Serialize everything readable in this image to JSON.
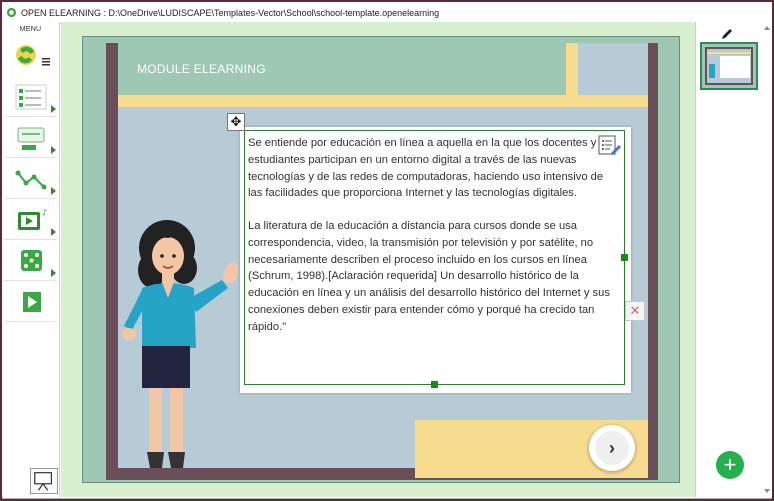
{
  "window": {
    "title": "OPEN ELEARNING : D:\\OneDrive\\LUDISCAPE\\Templates-Vector\\School\\school-template.openelearning"
  },
  "menu": {
    "label": "MENU"
  },
  "slide": {
    "module_title": "MODULE ELEARNING",
    "paragraph1": "Se entiende por educación en línea a aquella en la que los docentes y estudiantes participan en un entorno digital a través de las nuevas tecnologías y de las redes de computadoras, haciendo uso intensivo de las facilidades que proporciona Internet y las tecnologías digitales.",
    "paragraph2": "La literatura de la educación a distancia para cursos donde se usa correspondencia, video, la transmisión por televisión y por satélite, no necesariamente describen el proceso incluido en los cursos en línea (Schrum, 1998).[Aclaración requerida] Un desarrollo histórico de la educación en línea y un análisis del desarrollo histórico del Internet y sus conexiones deben existir para entender cómo y porqué ha crecido tan rápido.\""
  },
  "colors": {
    "accent_green": "#22b14c",
    "slide_teal": "#9ec8b4",
    "slide_yellow": "#f7dc90",
    "slide_frame": "#6a4e5a",
    "slide_sky": "#b7cbd6"
  }
}
